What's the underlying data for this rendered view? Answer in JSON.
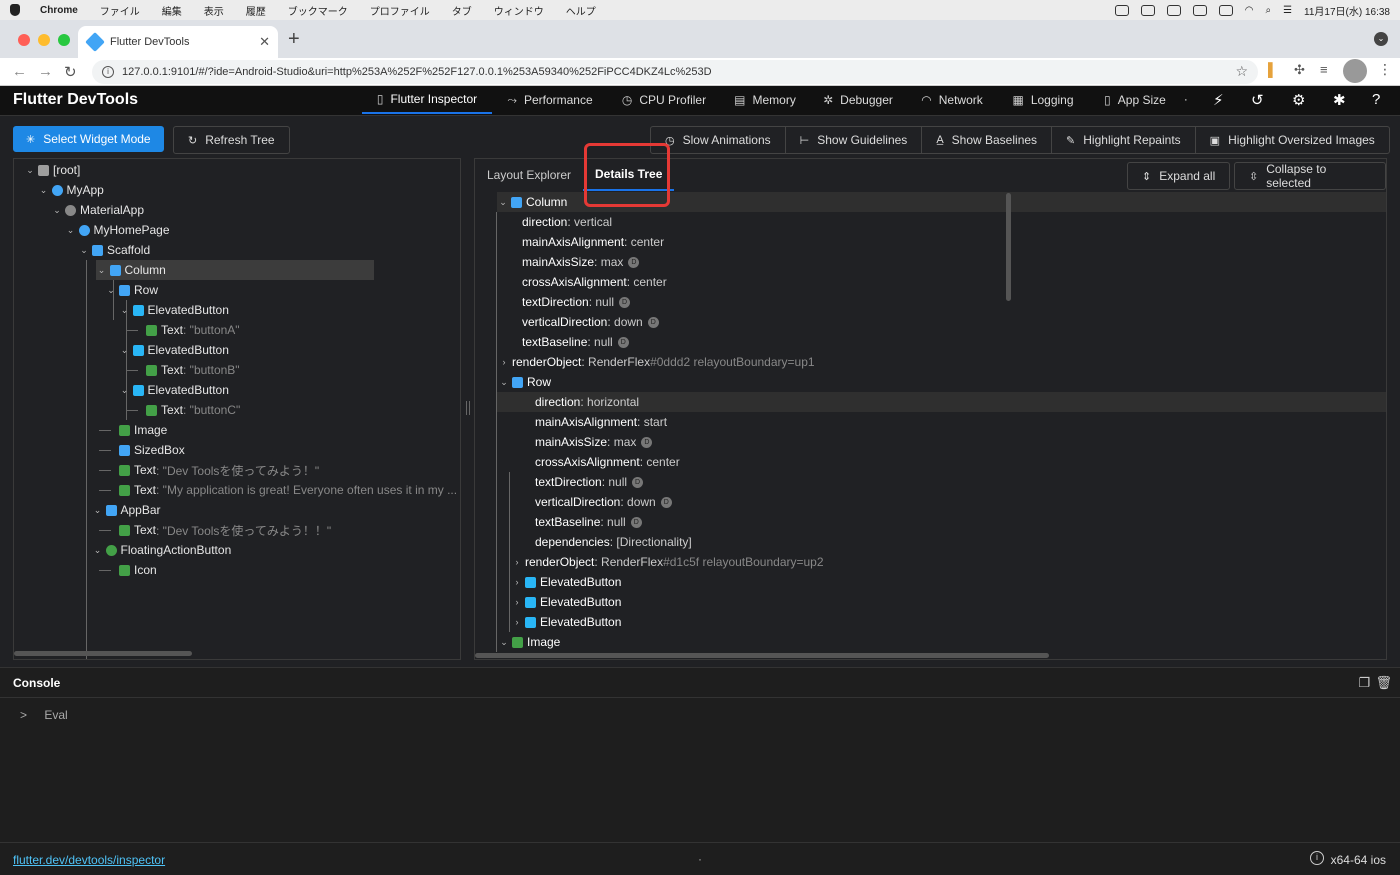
{
  "mac": {
    "menu": [
      "Chrome",
      "ファイル",
      "編集",
      "表示",
      "履歴",
      "ブックマーク",
      "プロファイル",
      "タブ",
      "ウィンドウ",
      "ヘルプ"
    ],
    "clock": "11月17日(水)  16:38"
  },
  "browser": {
    "tab_title": "Flutter DevTools",
    "url": "127.0.0.1:9101/#/?ide=Android-Studio&uri=http%253A%252F%252F127.0.0.1%253A59340%252FiPCC4DKZ4Lc%253D"
  },
  "app": {
    "title": "Flutter DevTools",
    "nav": [
      {
        "label": "Flutter Inspector",
        "icon": "phone-icon",
        "glyph": "▯"
      },
      {
        "label": "Performance",
        "icon": "performance-icon",
        "glyph": "⤳"
      },
      {
        "label": "CPU Profiler",
        "icon": "timer-icon",
        "glyph": "◷"
      },
      {
        "label": "Memory",
        "icon": "memory-icon",
        "glyph": "▤"
      },
      {
        "label": "Debugger",
        "icon": "bug-icon",
        "glyph": "✲"
      },
      {
        "label": "Network",
        "icon": "wifi-icon",
        "glyph": "◠"
      },
      {
        "label": "Logging",
        "icon": "logging-icon",
        "glyph": "▦"
      },
      {
        "label": "App Size",
        "icon": "app-size-icon",
        "glyph": "▯"
      }
    ],
    "nav_dot": "·"
  },
  "toolbar": {
    "select_widget_mode": "Select Widget Mode",
    "refresh_tree": "Refresh Tree",
    "slow_animations": "Slow Animations",
    "show_guidelines": "Show Guidelines",
    "show_baselines": "Show Baselines",
    "highlight_repaints": "Highlight Repaints",
    "highlight_oversized_images": "Highlight Oversized Images"
  },
  "widget_tree": [
    {
      "label": "[root]",
      "str": "",
      "icon": "folder-icon",
      "color": "#9e9e9e",
      "depth": 0,
      "chevron": true
    },
    {
      "label": "MyApp",
      "str": "",
      "icon": "stateless-icon",
      "color": "#42a5f5",
      "depth": 1,
      "chevron": true
    },
    {
      "label": "MaterialApp",
      "str": "",
      "icon": "material-app-icon",
      "color": "#888888",
      "depth": 2,
      "chevron": true
    },
    {
      "label": "MyHomePage",
      "str": "",
      "icon": "stateful-icon",
      "color": "#42a5f5",
      "depth": 3,
      "chevron": true
    },
    {
      "label": "Scaffold",
      "str": "",
      "icon": "scaffold-icon",
      "color": "#42a5f5",
      "depth": 4,
      "chevron": true
    },
    {
      "label": "Column",
      "str": "",
      "icon": "column-icon",
      "color": "#42a5f5",
      "depth": 5,
      "chevron": true,
      "selected": true
    },
    {
      "label": "Row",
      "str": "",
      "icon": "row-icon",
      "color": "#42a5f5",
      "depth": 6,
      "chevron": true
    },
    {
      "label": "ElevatedButton",
      "str": "",
      "icon": "button-icon",
      "color": "#29b6f6",
      "depth": 7,
      "chevron": true
    },
    {
      "label": "Text",
      "str": ": \"buttonA\"",
      "icon": "text-icon",
      "color": "#43a047",
      "depth": 8,
      "chevron": false
    },
    {
      "label": "ElevatedButton",
      "str": "",
      "icon": "button-icon",
      "color": "#29b6f6",
      "depth": 7,
      "chevron": true
    },
    {
      "label": "Text",
      "str": ": \"buttonB\"",
      "icon": "text-icon",
      "color": "#43a047",
      "depth": 8,
      "chevron": false
    },
    {
      "label": "ElevatedButton",
      "str": "",
      "icon": "button-icon",
      "color": "#29b6f6",
      "depth": 7,
      "chevron": true
    },
    {
      "label": "Text",
      "str": ": \"buttonC\"",
      "icon": "text-icon",
      "color": "#43a047",
      "depth": 8,
      "chevron": false
    },
    {
      "label": "Image",
      "str": "",
      "icon": "image-icon",
      "color": "#43a047",
      "depth": 6,
      "chevron": false
    },
    {
      "label": "SizedBox",
      "str": "",
      "icon": "sizedbox-icon",
      "color": "#42a5f5",
      "depth": 6,
      "chevron": false
    },
    {
      "label": "Text",
      "str": ": \"Dev Toolsを使ってみよう！\"",
      "icon": "text-icon",
      "color": "#43a047",
      "depth": 6,
      "chevron": false
    },
    {
      "label": "Text",
      "str": ": \"My application is great! Everyone often uses it in my ...",
      "icon": "text-icon",
      "color": "#43a047",
      "depth": 6,
      "chevron": false
    },
    {
      "label": "AppBar",
      "str": "",
      "icon": "appbar-icon",
      "color": "#42a5f5",
      "depth": 5,
      "chevron": true
    },
    {
      "label": "Text",
      "str": ": \"Dev Toolsを使ってみよう！！\"",
      "icon": "text-icon",
      "color": "#43a047",
      "depth": 6,
      "chevron": false
    },
    {
      "label": "FloatingActionButton",
      "str": "",
      "icon": "fab-icon",
      "color": "#43a047",
      "depth": 5,
      "chevron": true
    },
    {
      "label": "Icon",
      "str": "",
      "icon": "image-icon",
      "color": "#43a047",
      "depth": 6,
      "chevron": false
    }
  ],
  "details": {
    "tabs": [
      "Layout Explorer",
      "Details Tree"
    ],
    "active_tab": "Details Tree",
    "expand_all": "Expand all",
    "collapse_to_selected": "Collapse to selected",
    "rows": [
      {
        "k": "Column",
        "v": "",
        "v2": "",
        "depth": 0,
        "chevron": "v",
        "icon": "column-icon",
        "color": "#42a5f5",
        "badge": false,
        "selected": true
      },
      {
        "k": "direction",
        "v": ": vertical",
        "v2": "",
        "depth": 1,
        "chevron": "",
        "badge": false
      },
      {
        "k": "mainAxisAlignment",
        "v": ": center",
        "v2": "",
        "depth": 1,
        "chevron": "",
        "badge": false
      },
      {
        "k": "mainAxisSize",
        "v": ": max",
        "v2": "",
        "depth": 1,
        "chevron": "",
        "badge": true
      },
      {
        "k": "crossAxisAlignment",
        "v": ": center",
        "v2": "",
        "depth": 1,
        "chevron": "",
        "badge": false
      },
      {
        "k": "textDirection",
        "v": ": null",
        "v2": "",
        "depth": 1,
        "chevron": "",
        "badge": true
      },
      {
        "k": "verticalDirection",
        "v": ": down",
        "v2": "",
        "depth": 1,
        "chevron": "",
        "badge": true
      },
      {
        "k": "textBaseline",
        "v": ": null",
        "v2": "",
        "depth": 1,
        "chevron": "",
        "badge": true
      },
      {
        "k": "renderObject",
        "v": ": RenderFlex",
        "v2": "#0ddd2 relayoutBoundary=up1",
        "depth": 1,
        "chevron": ">",
        "badge": false
      },
      {
        "k": "Row",
        "v": "",
        "v2": "",
        "depth": 1,
        "chevron": "v",
        "icon": "row-icon",
        "color": "#42a5f5",
        "badge": false
      },
      {
        "k": "direction",
        "v": ": horizontal",
        "v2": "",
        "depth": 2,
        "chevron": "",
        "badge": false,
        "selected": true
      },
      {
        "k": "mainAxisAlignment",
        "v": ": start",
        "v2": "",
        "depth": 2,
        "chevron": "",
        "badge": false
      },
      {
        "k": "mainAxisSize",
        "v": ": max",
        "v2": "",
        "depth": 2,
        "chevron": "",
        "badge": true
      },
      {
        "k": "crossAxisAlignment",
        "v": ": center",
        "v2": "",
        "depth": 2,
        "chevron": "",
        "badge": false
      },
      {
        "k": "textDirection",
        "v": ": null",
        "v2": "",
        "depth": 2,
        "chevron": "",
        "badge": true
      },
      {
        "k": "verticalDirection",
        "v": ": down",
        "v2": "",
        "depth": 2,
        "chevron": "",
        "badge": true
      },
      {
        "k": "textBaseline",
        "v": ": null",
        "v2": "",
        "depth": 2,
        "chevron": "",
        "badge": true
      },
      {
        "k": "dependencies",
        "v": ": [Directionality]",
        "v2": "",
        "depth": 2,
        "chevron": "",
        "badge": false
      },
      {
        "k": "renderObject",
        "v": ": RenderFlex",
        "v2": "#d1c5f relayoutBoundary=up2",
        "depth": 2,
        "chevron": ">",
        "badge": false
      },
      {
        "k": "ElevatedButton",
        "v": "",
        "v2": "",
        "depth": 2,
        "chevron": ">",
        "icon": "button-icon",
        "color": "#29b6f6",
        "badge": false
      },
      {
        "k": "ElevatedButton",
        "v": "",
        "v2": "",
        "depth": 2,
        "chevron": ">",
        "icon": "button-icon",
        "color": "#29b6f6",
        "badge": false
      },
      {
        "k": "ElevatedButton",
        "v": "",
        "v2": "",
        "depth": 2,
        "chevron": ">",
        "icon": "button-icon",
        "color": "#29b6f6",
        "badge": false
      },
      {
        "k": "Image",
        "v": "",
        "v2": "",
        "depth": 1,
        "chevron": "v",
        "icon": "image-icon",
        "color": "#43a047",
        "badge": false
      }
    ]
  },
  "console": {
    "title": "Console",
    "eval_prompt": ">",
    "eval_label": "Eval"
  },
  "status": {
    "link": "flutter.dev/devtools/inspector",
    "dot": "·",
    "platform": "x64-64 ios"
  }
}
